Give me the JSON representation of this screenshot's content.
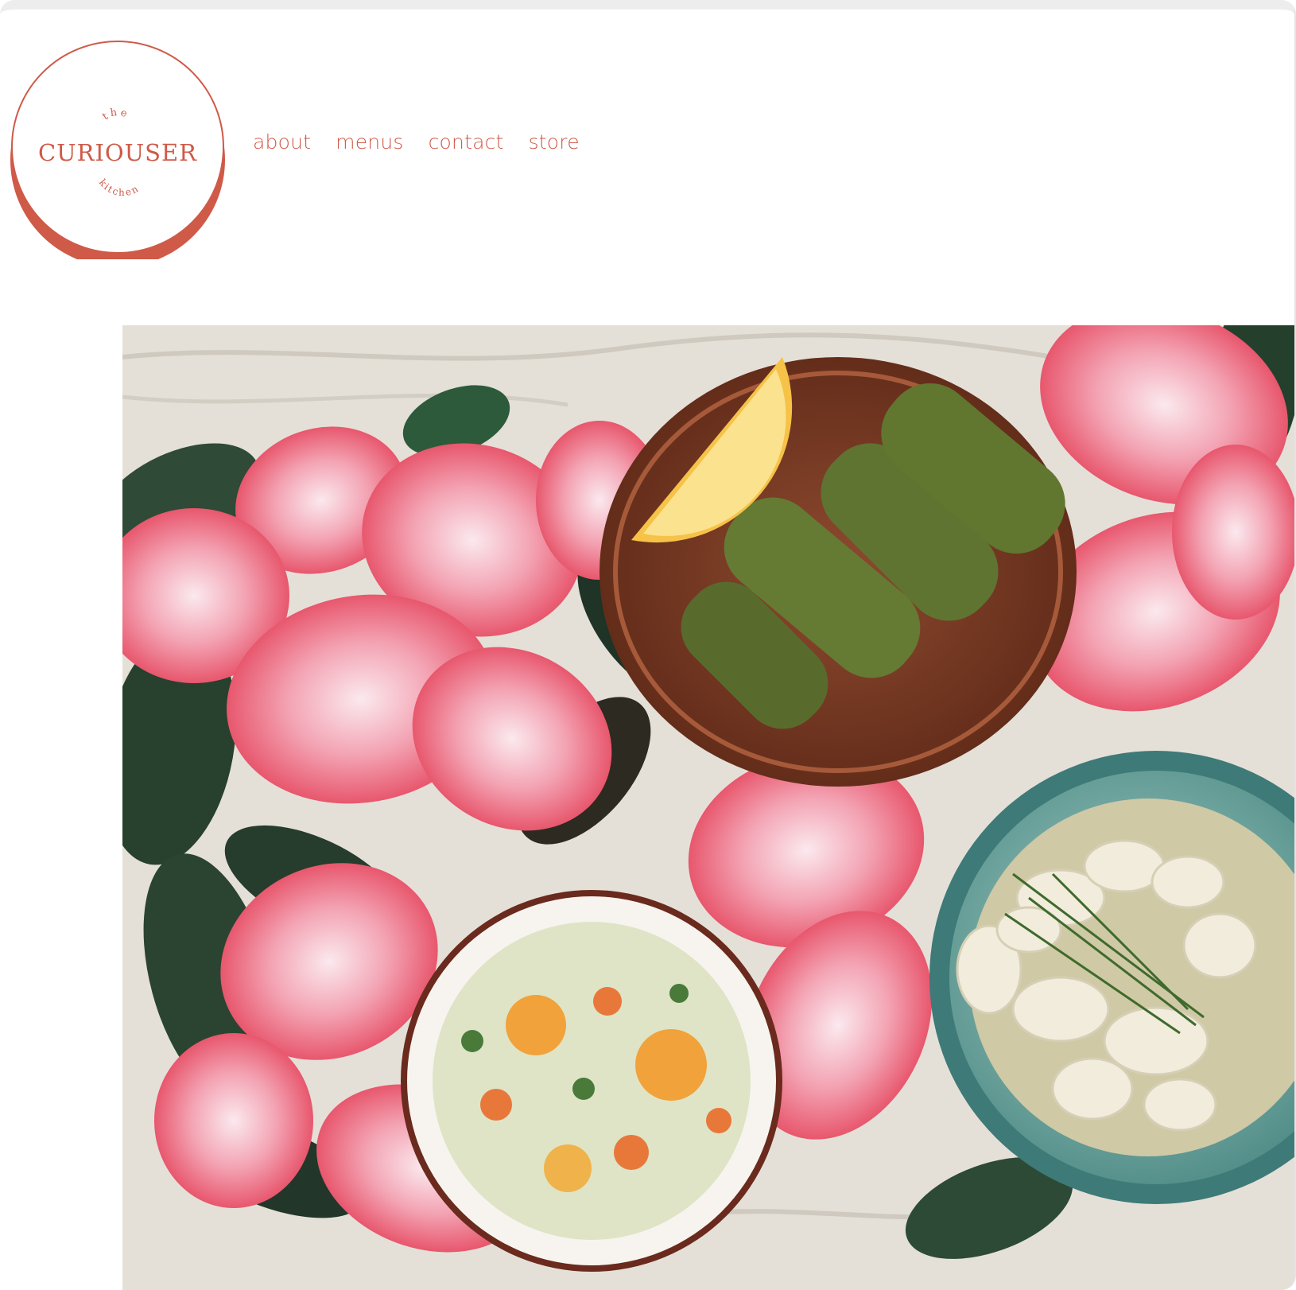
{
  "brand": {
    "logo_name": "the curiouser kitchen",
    "logo_top": "the",
    "logo_main": "CURIOUSER",
    "logo_bottom": "kitchen",
    "color": "#cf5a48"
  },
  "nav": {
    "items": [
      {
        "label": "about"
      },
      {
        "label": "menus"
      },
      {
        "label": "contact"
      },
      {
        "label": "store"
      }
    ]
  },
  "hero": {
    "icon": "food-photo",
    "colors": {
      "cloth": "#e4e0d8",
      "petal": "#e8455c",
      "leaf": "#2f4a36",
      "plate": "#7a3a24",
      "bowl_teal": "#6fa9a3"
    }
  }
}
